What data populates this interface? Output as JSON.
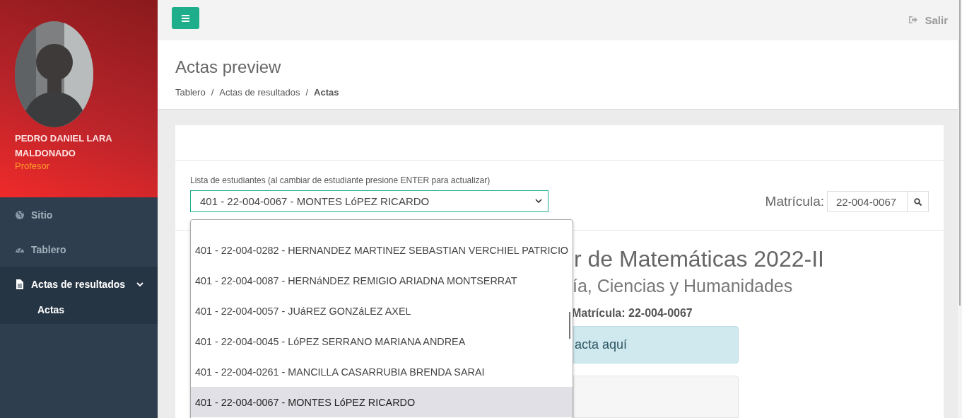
{
  "sidebar": {
    "user_name": "PEDRO DANIEL LARA MALDONADO",
    "role": "Profesor",
    "menu": [
      {
        "kind": "globe",
        "label": "Sitio",
        "selected": false
      },
      {
        "kind": "gauge",
        "label": "Tablero",
        "selected": false
      },
      {
        "kind": "file",
        "label": "Actas de resultados",
        "selected": true,
        "expanded": true,
        "children": [
          {
            "label": "Actas",
            "selected": true
          }
        ]
      }
    ]
  },
  "topbar": {
    "logout": "Salir"
  },
  "page_header": {
    "title": "Actas preview",
    "separator": "/",
    "breadcrumb": [
      {
        "label": "Tablero",
        "current": false
      },
      {
        "label": "Actas de resultados",
        "current": false
      },
      {
        "label": "Actas",
        "current": true
      }
    ]
  },
  "student_select": {
    "label": "Lista de estudiantes (al cambiar de estudiante presione ENTER para actualizar)",
    "value": "401 - 22-004-0067 - MONTES LóPEZ RICARDO",
    "open": true,
    "options": [
      {
        "label": "401 - 22-004-0282 - HERNANDEZ MARTINEZ SEBASTIAN VERCHIEL PATRICIO",
        "selected": false
      },
      {
        "label": "401 - 22-004-0087 - HERNáNDEZ REMIGIO ARIADNA MONTSERRAT",
        "selected": false
      },
      {
        "label": "401 - 22-004-0057 - JUáREZ GONZáLEZ AXEL",
        "selected": false
      },
      {
        "label": "401 - 22-004-0045 - LóPEZ SERRANO MARIANA ANDREA",
        "selected": false
      },
      {
        "label": "401 - 22-004-0261 - MANCILLA CASARRUBIA BRENDA SARAI",
        "selected": false
      },
      {
        "label": "401 - 22-004-0067 - MONTES LóPEZ RICARDO",
        "selected": true
      }
    ]
  },
  "matricula": {
    "label": "Matrícula:",
    "value": "22-004-0067"
  },
  "report": {
    "title": "r de Matemáticas 2022-II",
    "subtitle": "ía, Ciencias y Humanidades",
    "student_line": "Matrícula: 22-004-0067",
    "alert": "acta aquí"
  }
}
